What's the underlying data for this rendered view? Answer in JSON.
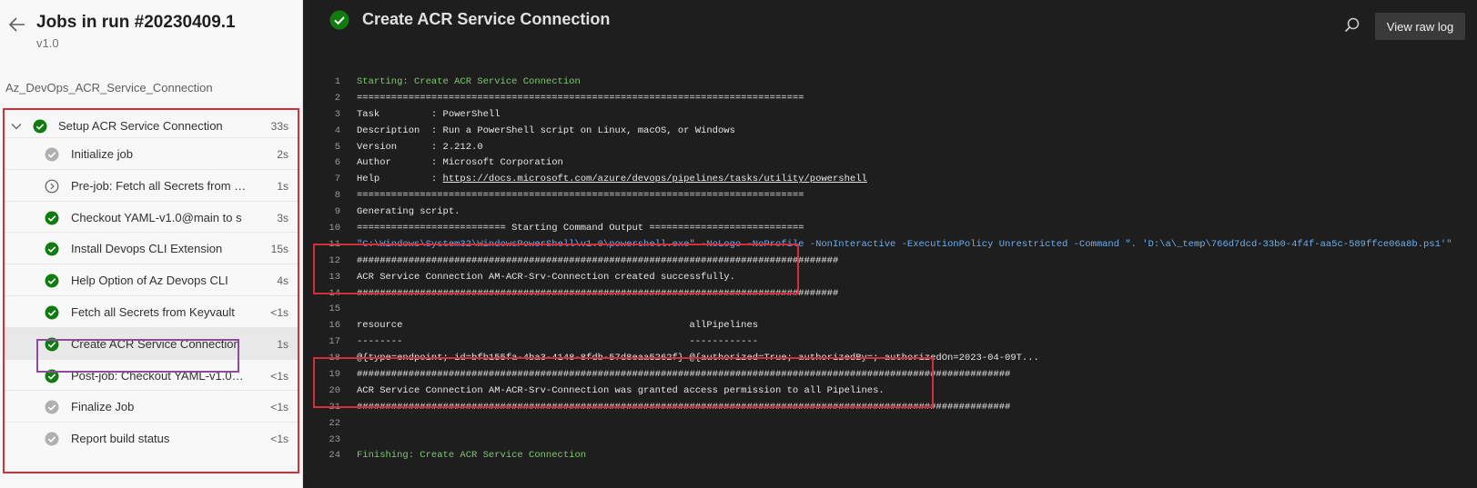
{
  "header": {
    "title": "Jobs in run #20230409.1",
    "version": "v1.0"
  },
  "stage": {
    "name": "Az_DevOps_ACR_Service_Connection"
  },
  "job": {
    "name": "Setup ACR Service Connection",
    "duration": "33s",
    "status": "success",
    "steps": [
      {
        "label": "Initialize job",
        "duration": "2s",
        "status": "skipped-grey"
      },
      {
        "label": "Pre-job: Fetch all Secrets from Key...",
        "duration": "1s",
        "status": "pending"
      },
      {
        "label": "Checkout YAML-v1.0@main to s",
        "duration": "3s",
        "status": "success"
      },
      {
        "label": "Install Devops CLI Extension",
        "duration": "15s",
        "status": "success"
      },
      {
        "label": "Help Option of Az Devops CLI",
        "duration": "4s",
        "status": "success"
      },
      {
        "label": "Fetch all Secrets from Keyvault",
        "duration": "<1s",
        "status": "success"
      },
      {
        "label": "Create ACR Service Connection",
        "duration": "1s",
        "status": "success",
        "selected": true
      },
      {
        "label": "Post-job: Checkout YAML-v1.0@...",
        "duration": "<1s",
        "status": "success"
      },
      {
        "label": "Finalize Job",
        "duration": "<1s",
        "status": "skipped-grey"
      },
      {
        "label": "Report build status",
        "duration": "<1s",
        "status": "skipped-grey"
      }
    ]
  },
  "log": {
    "title": "Create ACR Service Connection",
    "raw_log_label": "View raw log",
    "lines": [
      {
        "n": "1",
        "text": "Starting: Create ACR Service Connection",
        "style": "green"
      },
      {
        "n": "2",
        "text": "==============================================================================",
        "style": ""
      },
      {
        "n": "3",
        "text": "Task         : PowerShell",
        "style": ""
      },
      {
        "n": "4",
        "text": "Description  : Run a PowerShell script on Linux, macOS, or Windows",
        "style": ""
      },
      {
        "n": "5",
        "text": "Version      : 2.212.0",
        "style": ""
      },
      {
        "n": "6",
        "text": "Author       : Microsoft Corporation",
        "style": ""
      },
      {
        "n": "7",
        "text": "Help         : ",
        "link": "https://docs.microsoft.com/azure/devops/pipelines/tasks/utility/powershell",
        "style": ""
      },
      {
        "n": "8",
        "text": "==============================================================================",
        "style": ""
      },
      {
        "n": "9",
        "text": "Generating script.",
        "style": ""
      },
      {
        "n": "10",
        "text": "========================== Starting Command Output ===========================",
        "style": ""
      },
      {
        "n": "11",
        "text": "\"C:\\Windows\\System32\\WindowsPowerShell\\v1.0\\powershell.exe\" -NoLogo -NoProfile -NonInteractive -ExecutionPolicy Unrestricted -Command \". 'D:\\a\\_temp\\766d7dcd-33b0-4f4f-aa5c-589ffce06a8b.ps1'\"",
        "style": "blue"
      },
      {
        "n": "12",
        "text": "####################################################################################",
        "style": ""
      },
      {
        "n": "13",
        "text": "ACR Service Connection AM-ACR-Srv-Connection created successfully.",
        "style": ""
      },
      {
        "n": "14",
        "text": "####################################################################################",
        "style": ""
      },
      {
        "n": "15",
        "text": "",
        "style": ""
      },
      {
        "n": "16",
        "text": "resource                                                  allPipelines",
        "style": ""
      },
      {
        "n": "17",
        "text": "--------                                                  ------------",
        "style": ""
      },
      {
        "n": "18",
        "text": "@{type=endpoint; id=bfb155fa-4ba3-4148-8fdb-57d8eaa5262f} @{authorized=True; authorizedBy=; authorizedOn=2023-04-09T...",
        "style": ""
      },
      {
        "n": "19",
        "text": "##################################################################################################################",
        "style": ""
      },
      {
        "n": "20",
        "text": "ACR Service Connection AM-ACR-Srv-Connection was granted access permission to all Pipelines.",
        "style": ""
      },
      {
        "n": "21",
        "text": "##################################################################################################################",
        "style": ""
      },
      {
        "n": "22",
        "text": "",
        "style": ""
      },
      {
        "n": "23",
        "text": "",
        "style": ""
      },
      {
        "n": "24",
        "text": "Finishing: Create ACR Service Connection",
        "style": "green"
      }
    ]
  },
  "colors": {
    "success": "#107c10",
    "grey_status": "#b0b0b0",
    "highlight_red": "#d32f3a",
    "selection_purple": "#8e4a9e",
    "log_green": "#7ec96e",
    "log_blue": "#6ab0f3"
  }
}
